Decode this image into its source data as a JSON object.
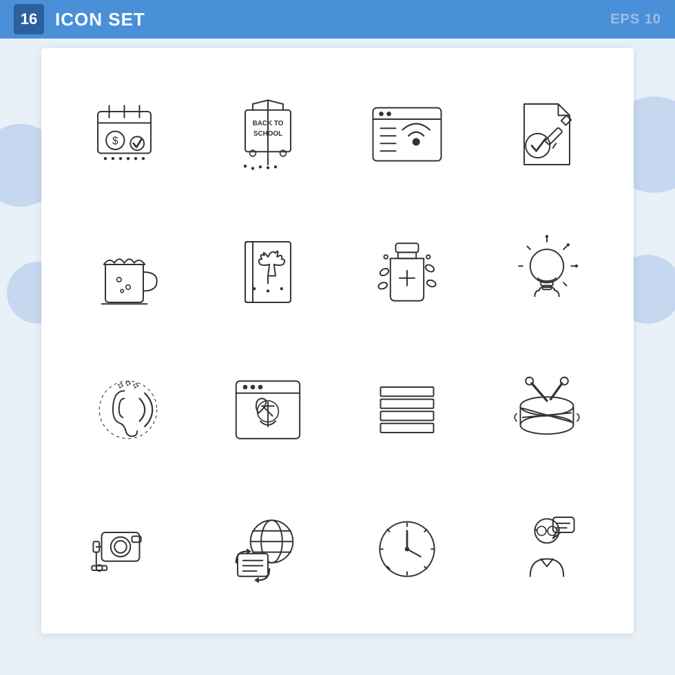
{
  "header": {
    "badge": "16",
    "title": "ICON SET",
    "eps": "EPS 10"
  },
  "icons": [
    {
      "name": "payment-calendar",
      "description": "Calendar with dollar coin and checkmark"
    },
    {
      "name": "back-to-school-sign",
      "description": "Back to School hanging sign"
    },
    {
      "name": "wifi-browser",
      "description": "Browser window with wifi signal"
    },
    {
      "name": "document-checkmark",
      "description": "Document with pen and checkmark"
    },
    {
      "name": "beer-mug",
      "description": "Beer mug with foam"
    },
    {
      "name": "cannabis-book",
      "description": "Book with cannabis leaf"
    },
    {
      "name": "medicine-bottle",
      "description": "Medicine bottle with cross and pills"
    },
    {
      "name": "lightbulb-idea",
      "description": "Light bulb with hand"
    },
    {
      "name": "hearing-aid",
      "description": "Ear with sound waves"
    },
    {
      "name": "browser-settings",
      "description": "Browser window with wrench"
    },
    {
      "name": "horizontal-lines",
      "description": "Stack of horizontal lines"
    },
    {
      "name": "drum",
      "description": "Drum with drumsticks"
    },
    {
      "name": "camera",
      "description": "Video camera on mount"
    },
    {
      "name": "global-news",
      "description": "Globe with document and arrows"
    },
    {
      "name": "clock",
      "description": "Clock face with hands"
    },
    {
      "name": "customer-support",
      "description": "Person with speech bubble"
    }
  ]
}
